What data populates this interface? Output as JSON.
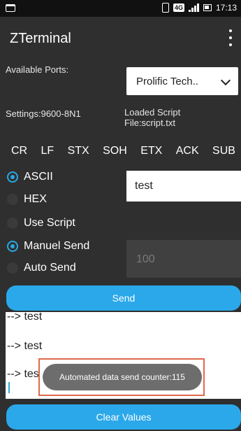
{
  "status": {
    "time": "17:13",
    "network": "4G"
  },
  "app": {
    "title": "ZTerminal"
  },
  "ports": {
    "label": "Available Ports:",
    "selected": "Prolific Tech.."
  },
  "info": {
    "settings": "Settings:9600-8N1",
    "loaded_line1": "Loaded Script",
    "loaded_line2": "File:script.txt"
  },
  "controls": [
    "CR",
    "LF",
    "STX",
    "SOH",
    "ETX",
    "ACK",
    "SUB"
  ],
  "modes": [
    {
      "label": "ASCII",
      "checked": true
    },
    {
      "label": "HEX",
      "checked": false
    },
    {
      "label": "Use Script",
      "checked": false
    },
    {
      "label": "Manuel Send",
      "checked": true
    },
    {
      "label": "Auto Send",
      "checked": false
    }
  ],
  "input": {
    "value": "test"
  },
  "interval": {
    "placeholder": "100"
  },
  "buttons": {
    "send": "Send",
    "clear": "Clear Values"
  },
  "log": {
    "lines": [
      "--> test",
      "--> test",
      "--> tes"
    ]
  },
  "toast": {
    "text": "Automated data send counter:115"
  },
  "colors": {
    "accent": "#2aa8ea",
    "highlight_border": "#e0694c"
  }
}
